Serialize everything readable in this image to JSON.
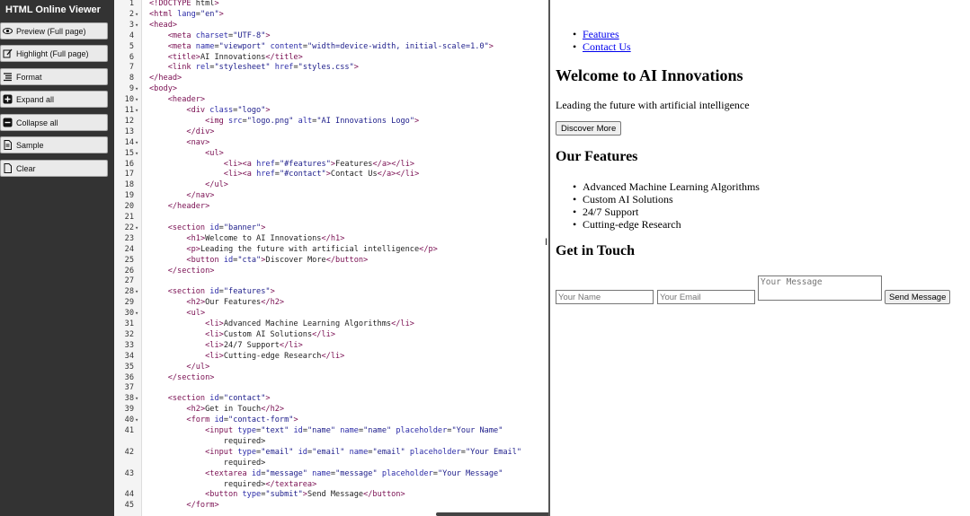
{
  "app": {
    "title": "HTML Online Viewer"
  },
  "toolbar": {
    "preview_label": "Preview (Full page)",
    "highlight_label": "Highlight (Full page)",
    "format_label": "Format",
    "expand_label": "Expand all",
    "collapse_label": "Collapse all",
    "sample_label": "Sample",
    "clear_label": "Clear"
  },
  "editor": {
    "lines": [
      {
        "n": "1",
        "fold": "",
        "text": "<!DOCTYPE html>"
      },
      {
        "n": "2",
        "fold": "▾",
        "text": "<html lang=\"en\">"
      },
      {
        "n": "3",
        "fold": "▾",
        "text": "<head>"
      },
      {
        "n": "4",
        "fold": "",
        "text": "    <meta charset=\"UTF-8\">"
      },
      {
        "n": "5",
        "fold": "",
        "text": "    <meta name=\"viewport\" content=\"width=device-width, initial-scale=1.0\">"
      },
      {
        "n": "6",
        "fold": "",
        "text": "    <title>AI Innovations</title>"
      },
      {
        "n": "7",
        "fold": "",
        "text": "    <link rel=\"stylesheet\" href=\"styles.css\">"
      },
      {
        "n": "8",
        "fold": "",
        "text": "</head>"
      },
      {
        "n": "9",
        "fold": "▾",
        "text": "<body>"
      },
      {
        "n": "10",
        "fold": "▾",
        "text": "    <header>"
      },
      {
        "n": "11",
        "fold": "▾",
        "text": "        <div class=\"logo\">"
      },
      {
        "n": "12",
        "fold": "",
        "text": "            <img src=\"logo.png\" alt=\"AI Innovations Logo\">"
      },
      {
        "n": "13",
        "fold": "",
        "text": "        </div>"
      },
      {
        "n": "14",
        "fold": "▾",
        "text": "        <nav>"
      },
      {
        "n": "15",
        "fold": "▾",
        "text": "            <ul>"
      },
      {
        "n": "16",
        "fold": "",
        "text": "                <li><a href=\"#features\">Features</a></li>"
      },
      {
        "n": "17",
        "fold": "",
        "text": "                <li><a href=\"#contact\">Contact Us</a></li>"
      },
      {
        "n": "18",
        "fold": "",
        "text": "            </ul>"
      },
      {
        "n": "19",
        "fold": "",
        "text": "        </nav>"
      },
      {
        "n": "20",
        "fold": "",
        "text": "    </header>"
      },
      {
        "n": "21",
        "fold": "",
        "text": ""
      },
      {
        "n": "22",
        "fold": "▾",
        "text": "    <section id=\"banner\">"
      },
      {
        "n": "23",
        "fold": "",
        "text": "        <h1>Welcome to AI Innovations</h1>"
      },
      {
        "n": "24",
        "fold": "",
        "text": "        <p>Leading the future with artificial intelligence</p>"
      },
      {
        "n": "25",
        "fold": "",
        "text": "        <button id=\"cta\">Discover More</button>"
      },
      {
        "n": "26",
        "fold": "",
        "text": "    </section>"
      },
      {
        "n": "27",
        "fold": "",
        "text": ""
      },
      {
        "n": "28",
        "fold": "▾",
        "text": "    <section id=\"features\">"
      },
      {
        "n": "29",
        "fold": "",
        "text": "        <h2>Our Features</h2>"
      },
      {
        "n": "30",
        "fold": "▾",
        "text": "        <ul>"
      },
      {
        "n": "31",
        "fold": "",
        "text": "            <li>Advanced Machine Learning Algorithms</li>"
      },
      {
        "n": "32",
        "fold": "",
        "text": "            <li>Custom AI Solutions</li>"
      },
      {
        "n": "33",
        "fold": "",
        "text": "            <li>24/7 Support</li>"
      },
      {
        "n": "34",
        "fold": "",
        "text": "            <li>Cutting-edge Research</li>"
      },
      {
        "n": "35",
        "fold": "",
        "text": "        </ul>"
      },
      {
        "n": "36",
        "fold": "",
        "text": "    </section>"
      },
      {
        "n": "37",
        "fold": "",
        "text": ""
      },
      {
        "n": "38",
        "fold": "▾",
        "text": "    <section id=\"contact\">"
      },
      {
        "n": "39",
        "fold": "",
        "text": "        <h2>Get in Touch</h2>"
      },
      {
        "n": "40",
        "fold": "▾",
        "text": "        <form id=\"contact-form\">"
      },
      {
        "n": "41",
        "fold": "",
        "text": "            <input type=\"text\" id=\"name\" name=\"name\" placeholder=\"Your Name\""
      },
      {
        "n": "",
        "fold": "",
        "text": "                required>"
      },
      {
        "n": "42",
        "fold": "",
        "text": "            <input type=\"email\" id=\"email\" name=\"email\" placeholder=\"Your Email\""
      },
      {
        "n": "",
        "fold": "",
        "text": "                required>"
      },
      {
        "n": "43",
        "fold": "",
        "text": "            <textarea id=\"message\" name=\"message\" placeholder=\"Your Message\""
      },
      {
        "n": "",
        "fold": "",
        "text": "                required></textarea>"
      },
      {
        "n": "44",
        "fold": "",
        "text": "            <button type=\"submit\">Send Message</button>"
      },
      {
        "n": "45",
        "fold": "",
        "text": "        </form>"
      }
    ]
  },
  "preview": {
    "nav": [
      "Features",
      "Contact Us"
    ],
    "h1": "Welcome to AI Innovations",
    "lead": "Leading the future with artificial intelligence",
    "cta": "Discover More",
    "features_heading": "Our Features",
    "features": [
      "Advanced Machine Learning Algorithms",
      "Custom AI Solutions",
      "24/7 Support",
      "Cutting-edge Research"
    ],
    "contact_heading": "Get in Touch",
    "name_placeholder": "Your Name",
    "email_placeholder": "Your Email",
    "message_placeholder": "Your Message",
    "send_label": "Send Message"
  },
  "colors": {
    "toolbar_bg": "#333333",
    "tag": "#7a0f52",
    "attr": "#2b2ba8",
    "link": "#0000ee"
  }
}
